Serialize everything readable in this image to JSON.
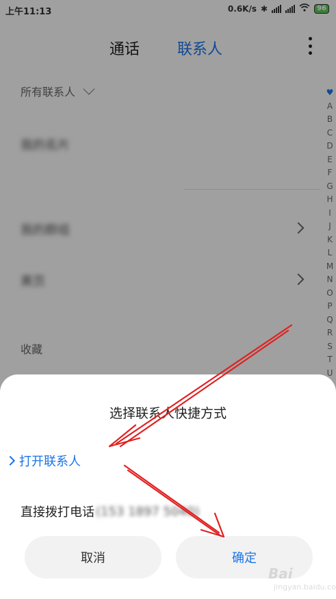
{
  "status_bar": {
    "time": "上午11:13",
    "speed": "0.6K/s",
    "battery": "96"
  },
  "tabs": {
    "calls": "通话",
    "contacts": "联系人"
  },
  "filter": {
    "label": "所有联系人"
  },
  "contacts_list": {
    "my_card": "我的名片",
    "my_groups": "我的群组",
    "yellow_pages": "黄页",
    "favorites": "收藏"
  },
  "index_bar": [
    "A",
    "B",
    "C",
    "D",
    "E",
    "F",
    "G",
    "H",
    "I",
    "J",
    "K",
    "L",
    "M",
    "N",
    "O",
    "P",
    "Q",
    "R",
    "S",
    "T",
    "U"
  ],
  "dialog": {
    "title": "选择联系人快捷方式",
    "option_open": "打开联系人",
    "option_call": "直接拨打电话",
    "option_call_number": "(153 1897 5040)",
    "cancel": "取消",
    "confirm": "确定"
  },
  "watermark": {
    "brand": "Bai",
    "sub": "jingyan.baidu.com"
  },
  "colors": {
    "accent": "#1a73e8",
    "annotation_arrow": "#e02020"
  }
}
